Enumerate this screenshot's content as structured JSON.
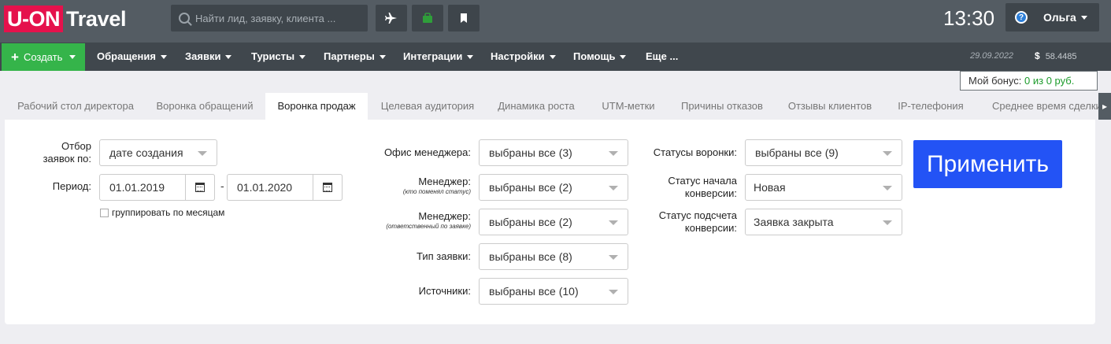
{
  "header": {
    "logo_main": "U-ON",
    "logo_sub": "Travel",
    "search_placeholder": "Найти лид, заявку, клиента ...",
    "clock": "13:30",
    "user_name": "Ольга",
    "icons": [
      "search-icon",
      "plane-icon",
      "bag-icon",
      "bookmark-icon",
      "help-icon"
    ]
  },
  "nav": {
    "create_label": "Создать",
    "items": [
      "Обращения",
      "Заявки",
      "Туристы",
      "Партнеры",
      "Интеграции",
      "Настройки",
      "Помощь",
      "Еще ..."
    ],
    "date": "29.09.2022",
    "currency_symbol": "$",
    "balance": "58.4485"
  },
  "bonus": {
    "label": "Мой бонус:",
    "value": "0 из 0 руб."
  },
  "tabs": [
    "Рабочий стол директора",
    "Воронка обращений",
    "Воронка продаж",
    "Целевая аудитория",
    "Динамика роста",
    "UTM-метки",
    "Причины отказов",
    "Отзывы клиентов",
    "IP-телефония",
    "Среднее время сделки"
  ],
  "active_tab": "Воронка продаж",
  "filters": {
    "selection_label": "Отбор заявок по:",
    "selection_value": "дате создания",
    "period_label": "Период:",
    "date_from": "01.01.2019",
    "date_separator": "-",
    "date_to": "01.01.2020",
    "group_by_month": "группировать по месяцам",
    "office_label": "Офис менеджера:",
    "office_value": "выбраны все (3)",
    "manager_changed_label": "Менеджер:",
    "manager_changed_sub": "(кто поменял статус)",
    "manager_changed_value": "выбраны все (2)",
    "manager_resp_label": "Менеджер:",
    "manager_resp_sub": "(ответственный по заявке)",
    "manager_resp_value": "выбраны все (2)",
    "type_label": "Тип заявки:",
    "type_value": "выбраны все (8)",
    "sources_label": "Источники:",
    "sources_value": "выбраны все (10)",
    "funnel_status_label": "Статусы воронки:",
    "funnel_status_value": "выбраны все (9)",
    "conv_start_label": "Статус начала конверсии:",
    "conv_start_value": "Новая",
    "conv_count_label": "Статус подсчета конверсии:",
    "conv_count_value": "Заявка закрыта",
    "apply_label": "Применить"
  },
  "colors": {
    "brand": "#e5114c",
    "create": "#35b44a",
    "apply": "#2353f5",
    "topbar": "#545c63",
    "navbar": "#40474d"
  }
}
